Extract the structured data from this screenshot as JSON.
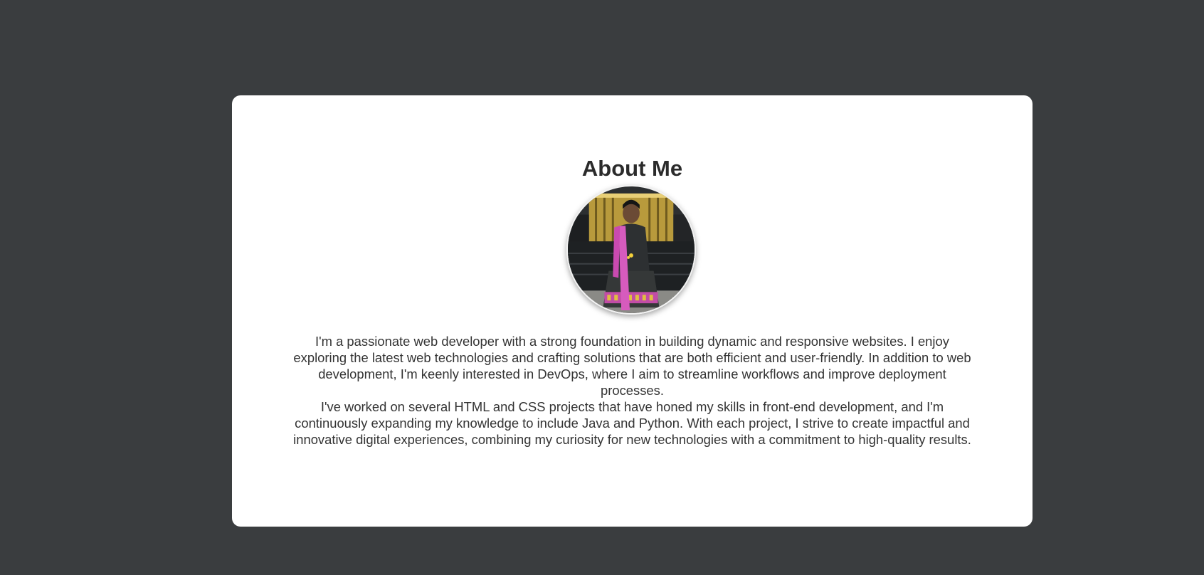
{
  "about": {
    "title": "About Me",
    "paragraphs": [
      "I'm a passionate web developer with a strong foundation in building dynamic and responsive websites. I enjoy exploring the latest web technologies and crafting solutions that are both efficient and user-friendly. In addition to web development, I'm keenly interested in DevOps, where I aim to streamline workflows and improve deployment processes.",
      "I've worked on several HTML and CSS projects that have honed my skills in front-end development, and I'm continuously expanding my knowledge to include Java and Python. With each project, I strive to create impactful and innovative digital experiences, combining my curiosity for new technologies with a commitment to high-quality results."
    ]
  },
  "colors": {
    "page_background": "#3a3d3f",
    "card_background": "#ffffff",
    "text": "#333333"
  }
}
